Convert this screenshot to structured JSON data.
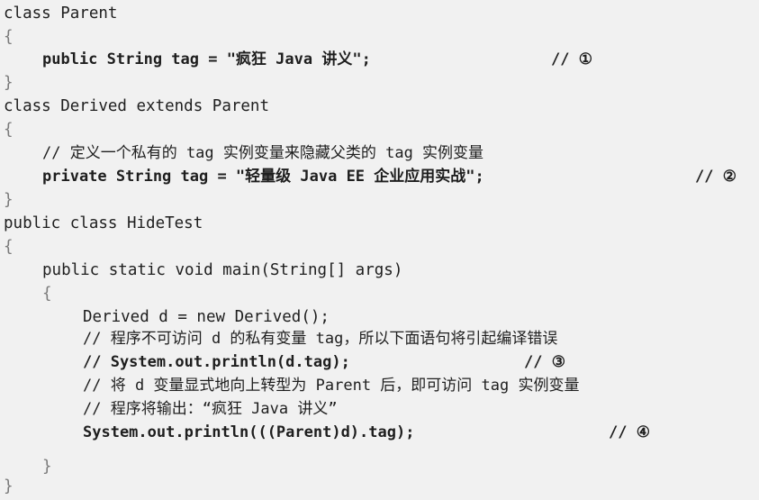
{
  "code": {
    "lines": [
      "class Parent",
      "{",
      "public String tag = \"疯狂 Java 讲义\";",
      "}",
      "class Derived extends Parent",
      "{",
      "// 定义一个私有的 tag 实例变量来隐藏父类的 tag 实例变量",
      "private String tag = \"轻量级 Java EE 企业应用实战\";",
      "}",
      "public class HideTest",
      "{",
      "public static void main(String[] args)",
      "{",
      "Derived d = new Derived();",
      "// 程序不可访问 d 的私有变量 tag，所以下面语句将引起编译错误",
      "// System.out.println(d.tag);",
      "// 将 d 变量显式地向上转型为 Parent 后，即可访问 tag 实例变量",
      "// 程序将输出：“疯狂 Java 讲义”",
      "System.out.println(((Parent)d).tag);",
      "}",
      "}"
    ],
    "markers": {
      "m1": "// ①",
      "m2": "// ②",
      "m3": "// ③",
      "m4": "// ④"
    }
  }
}
